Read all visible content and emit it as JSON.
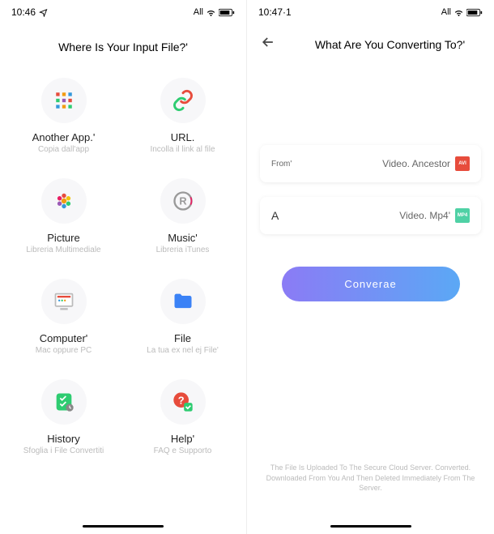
{
  "left": {
    "status": {
      "time": "10:46",
      "network": "All"
    },
    "title": "Where Is Your Input File?'",
    "items": [
      {
        "title": "Another App.'",
        "subtitle": "Copia dall'app",
        "icon": "apps-icon"
      },
      {
        "title": "URL.",
        "subtitle": "Incolla il link al file",
        "icon": "link-icon"
      },
      {
        "title": "Picture",
        "subtitle": "Libreria Multimediale",
        "icon": "picture-icon"
      },
      {
        "title": "Music'",
        "subtitle": "Libreria iTunes",
        "icon": "music-icon"
      },
      {
        "title": "Computer'",
        "subtitle": "Mac oppure PC",
        "icon": "computer-icon"
      },
      {
        "title": "File",
        "subtitle": "La tua ex nel ej File'",
        "icon": "file-icon"
      },
      {
        "title": "History",
        "subtitle": "Sfoglia i File Convertiti",
        "icon": "history-icon"
      },
      {
        "title": "Help'",
        "subtitle": "FAQ e Supporto",
        "icon": "help-icon"
      }
    ]
  },
  "right": {
    "status": {
      "time": "10:47·1",
      "network": "All"
    },
    "title": "What Are You Converting To?'",
    "options": [
      {
        "from": "From'",
        "to": "Video. Ancestor",
        "badge": "AVI",
        "badgeClass": "badge-avi"
      },
      {
        "from": "A",
        "to": "Video. Mp4'",
        "badge": "MP4",
        "badgeClass": "badge-mp4"
      }
    ],
    "button": "Converae",
    "footer": "The File Is Uploaded To The Secure Cloud Server. Converted.\nDownloaded From You And Then Deleted Immediately From The Server."
  }
}
